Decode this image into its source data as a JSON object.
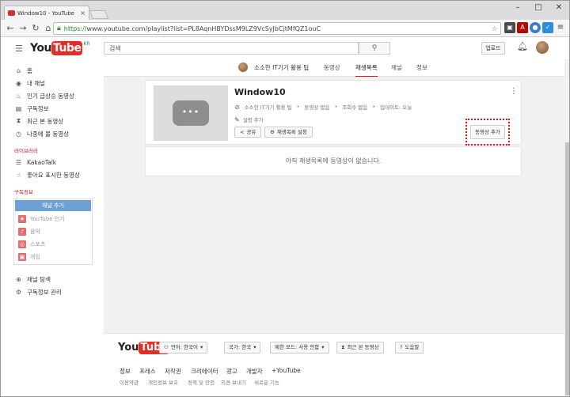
{
  "browser": {
    "tab_title": "Window10 - YouTube",
    "tab_close": "×",
    "url_https": "https://",
    "url_rest": "www.youtube.com/playlist?list=PL8AqnHBYDssM9LZ9VcSyJbCjtMfQZ1ouC",
    "window_controls": [
      "–",
      "□",
      "✕"
    ]
  },
  "header": {
    "logo_you": "You",
    "logo_tube": "Tube",
    "logo_region": "KR",
    "search_placeholder": "검색",
    "upload_label": "업로드"
  },
  "channel": {
    "name": "소소한 IT기기 활용 팁",
    "tabs": [
      "동영상",
      "재생목록",
      "채널",
      "정보"
    ],
    "active_tab": "재생목록"
  },
  "sidebar": {
    "items": [
      {
        "label": "홈",
        "icon": "home-icon"
      },
      {
        "label": "내 채널",
        "icon": "person-icon"
      },
      {
        "label": "인기 급상승 동영상",
        "icon": "flame-icon"
      },
      {
        "label": "구독정보",
        "icon": "subscriptions-icon"
      },
      {
        "label": "최근 본 동영상",
        "icon": "hourglass-icon"
      },
      {
        "label": "나중에 볼 동영상",
        "icon": "clock-icon"
      }
    ],
    "library_heading": "라이브러리",
    "library_items": [
      {
        "label": "KakaoTalk",
        "icon": "playlist-icon"
      },
      {
        "label": "좋아요 표시한 동영상",
        "icon": "thumbs-up-icon"
      }
    ],
    "subs_heading": "구독정보",
    "add_channel_label": "채널 추가",
    "sub_items": [
      {
        "label": "YouTube 인기",
        "icon": "star-icon"
      },
      {
        "label": "음악",
        "icon": "music-icon"
      },
      {
        "label": "스포츠",
        "icon": "sports-icon"
      },
      {
        "label": "게임",
        "icon": "game-icon"
      }
    ],
    "bottom_items": [
      {
        "label": "채널 탐색",
        "icon": "browse-icon"
      },
      {
        "label": "구독정보 관리",
        "icon": "gear-icon"
      }
    ]
  },
  "playlist": {
    "title": "Window10",
    "meta": [
      "소소한 IT기기 활용 팁",
      "동영상 없음",
      "조회수 없음",
      "업데이트: 오늘"
    ],
    "desc_label": "설명 추가",
    "share_label": "공유",
    "settings_label": "재생목록 설정",
    "add_video_label": "동영상 추가",
    "empty_message": "아직 재생목록에 동영상이 없습니다."
  },
  "footer": {
    "language_label": "언어: 한국어",
    "country_label": "국가: 한국",
    "safety_label": "제한 모드: 사용 안함",
    "history_label": "최근 본 동영상",
    "help_label": "도움말",
    "links": [
      "정보",
      "프레스",
      "저작권",
      "크리에이터",
      "광고",
      "개발자",
      "+YouTube"
    ],
    "sub_links": [
      "이용약관",
      "개인정보 보호",
      "정책 및 안전",
      "의견 보내기",
      "새로운 기능"
    ]
  },
  "colors": {
    "brand_red": "#e52d27",
    "add_channel_blue": "#6da1d5",
    "highlight_red": "#cc1a1a"
  }
}
